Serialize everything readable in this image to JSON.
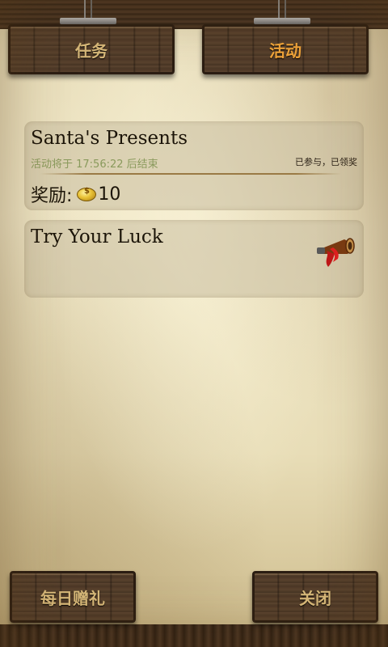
{
  "tabs": [
    {
      "label": "任务",
      "active": false
    },
    {
      "label": "活动",
      "active": true
    }
  ],
  "events": [
    {
      "title": "Santa's Presents",
      "countdown": "活动将于 17:56:22 后结束",
      "status": "已参与，已领奖",
      "reward_label": "奖励:",
      "reward_icon": "gold-coin-icon",
      "reward_value": "10"
    },
    {
      "title": "Try Your Luck",
      "icon": "horn-icon"
    }
  ],
  "footer": {
    "daily_gift_label": "每日赠礼",
    "close_label": "关闭"
  },
  "colors": {
    "tab_active": "#f0a43a",
    "tab_inactive": "#d8b97a",
    "countdown": "#8a9a5c"
  }
}
